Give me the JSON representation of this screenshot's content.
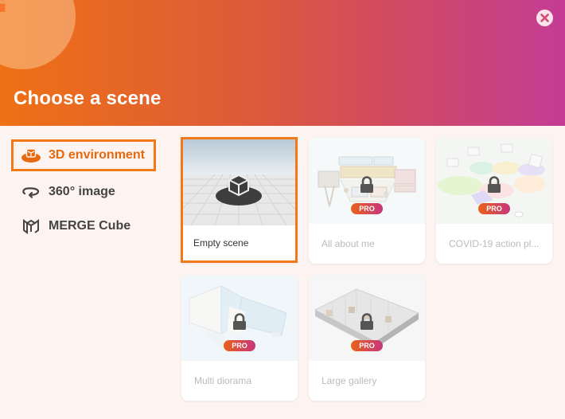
{
  "dialog": {
    "title": "Choose a scene",
    "help_icon": "question-mark-icon",
    "close_icon": "close-icon"
  },
  "sidebar": {
    "items": [
      {
        "label": "3D environment",
        "icon": "3d-environment-icon",
        "active": true
      },
      {
        "label": "360° image",
        "icon": "360-image-icon",
        "active": false
      },
      {
        "label": "MERGE Cube",
        "icon": "merge-cube-icon",
        "active": false
      }
    ]
  },
  "scenes": [
    {
      "label": "Empty scene",
      "pro": false,
      "locked": false,
      "selected": true
    },
    {
      "label": "All about me",
      "pro": true,
      "locked": true,
      "badge": "PRO"
    },
    {
      "label": "COVID-19 action pl...",
      "pro": true,
      "locked": true,
      "badge": "PRO"
    },
    {
      "label": "Multi diorama",
      "pro": true,
      "locked": true,
      "badge": "PRO"
    },
    {
      "label": "Large gallery",
      "pro": true,
      "locked": true,
      "badge": "PRO"
    }
  ],
  "colors": {
    "accent": "#f07a1a",
    "header_start": "#ee7115",
    "header_end": "#c43c95"
  }
}
